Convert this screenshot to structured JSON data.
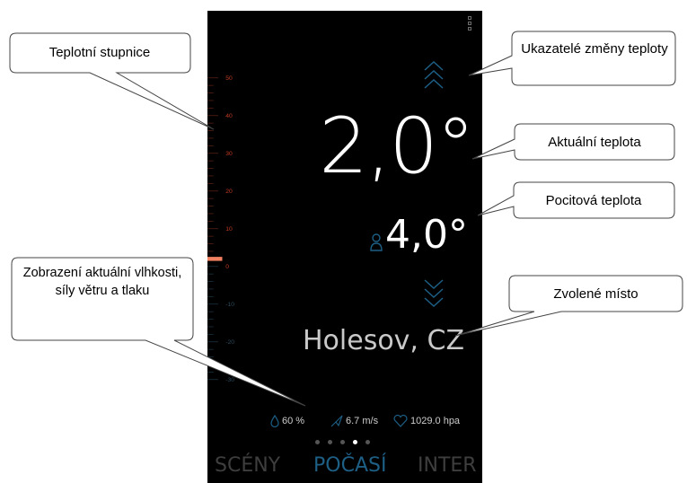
{
  "scale": {
    "ticks": [
      "50",
      "40",
      "30",
      "20",
      "10",
      "0",
      "-10",
      "-20",
      "-30"
    ],
    "current_marker_value": 2.0,
    "accent_color": "#c23b22",
    "marker_color": "#f08060"
  },
  "weather": {
    "temperature": "2,0°",
    "feels_like": "4,0°",
    "location": "Holesov, CZ",
    "humidity": "60 %",
    "wind": "6.7 m/s",
    "pressure": "1029.0 hpa"
  },
  "pager": {
    "count": 5,
    "active_index": 3
  },
  "nav": {
    "left": "SCÉNY",
    "center": "POČASÍ",
    "right": "INTER"
  },
  "callouts": {
    "scale": "Teplotní stupnice",
    "change": "Ukazatelé změny teploty",
    "current": "Aktuální teplota",
    "feels": "Pocitová teplota",
    "location": "Zvolené místo",
    "stats": "Zobrazení aktuální vlhkosti, síly větru a tlaku"
  },
  "colors": {
    "accent_blue": "#1d5f85",
    "background": "#000000"
  }
}
